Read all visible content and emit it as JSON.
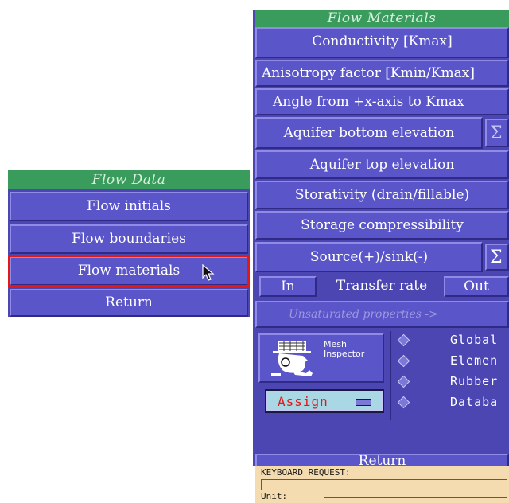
{
  "flow_data": {
    "title": "Flow Data",
    "items": [
      "Flow initials",
      "Flow boundaries",
      "Flow materials",
      "Return"
    ]
  },
  "flow_materials": {
    "title": "Flow Materials",
    "conductivity": "Conductivity [Kmax]",
    "anisotropy": "Anisotropy factor [Kmin/Kmax]",
    "angle": "Angle from +x-axis to Kmax",
    "aquifer_bottom": "Aquifer bottom elevation",
    "aquifer_top": "Aquifer top elevation",
    "storativity": "Storativity (drain/fillable)",
    "storage_comp": "Storage compressibility",
    "source_sink": "Source(+)/sink(-)",
    "sigma": "Σ",
    "in_label": "In",
    "transfer_rate": "Transfer rate",
    "out_label": "Out",
    "unsaturated": "Unsaturated properties ->",
    "mesh_inspector": "Mesh Inspector",
    "assign": "Assign",
    "radio_options": [
      "Global",
      "Elemen",
      "Rubber",
      "Databa"
    ],
    "return": "Return"
  },
  "keyboard": {
    "request_label": "KEYBOARD REQUEST:",
    "input_value": "",
    "unit_label": "Unit:"
  },
  "colors": {
    "button": "#5a55c8",
    "title_bar": "#3a9c5c",
    "selected_outline": "#e01818",
    "assign_text": "#e01818",
    "keyboard_bg": "#f4dcb0"
  }
}
